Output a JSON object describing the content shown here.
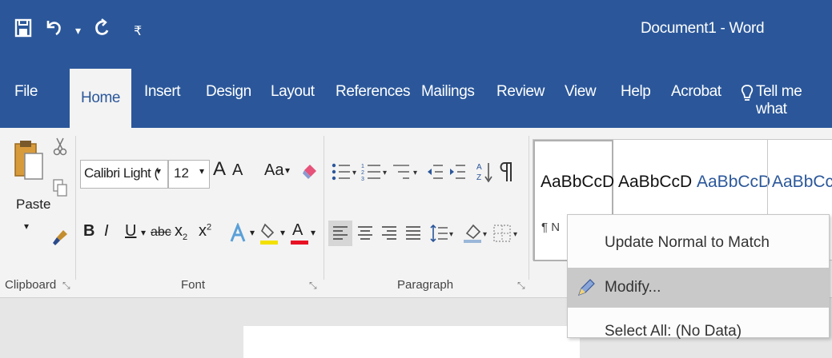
{
  "title_bar": {
    "document_title": "Document1  -  Word",
    "icons": [
      "save-icon",
      "undo-icon",
      "redo-icon",
      "customize-qat-icon"
    ]
  },
  "tabs": [
    {
      "label": "File"
    },
    {
      "label": "Home"
    },
    {
      "label": "Insert"
    },
    {
      "label": "Design"
    },
    {
      "label": "Layout"
    },
    {
      "label": "References"
    },
    {
      "label": "Mailings"
    },
    {
      "label": "Review"
    },
    {
      "label": "View"
    },
    {
      "label": "Help"
    },
    {
      "label": "Acrobat"
    },
    {
      "label": "Tell me what"
    }
  ],
  "clipboard": {
    "paste_label": "Paste",
    "group_label": "Clipboard"
  },
  "font": {
    "font_name": "Calibri Light (",
    "font_size": "12",
    "grow_font": "A",
    "shrink_font": "A",
    "change_case": "Aa",
    "bold": "B",
    "italic": "I",
    "underline": "U",
    "strikethrough": "abc",
    "subscript": "x",
    "superscript": "x",
    "font_color": "A",
    "group_label": "Font"
  },
  "paragraph": {
    "group_label": "Paragraph"
  },
  "styles": {
    "samples": [
      "AaBbCcD",
      "AaBbCcD",
      "AaBbCcD",
      "AaBbCcD"
    ],
    "first_style_name": "¶ N"
  },
  "context_menu": {
    "items": [
      "Update Normal to Match Selection",
      "Modify...",
      "Select All: (No Data)"
    ]
  },
  "colors": {
    "brand": "#2b579a",
    "ribbon": "#f3f3f3",
    "menu_highlight": "#c9c9c9"
  }
}
